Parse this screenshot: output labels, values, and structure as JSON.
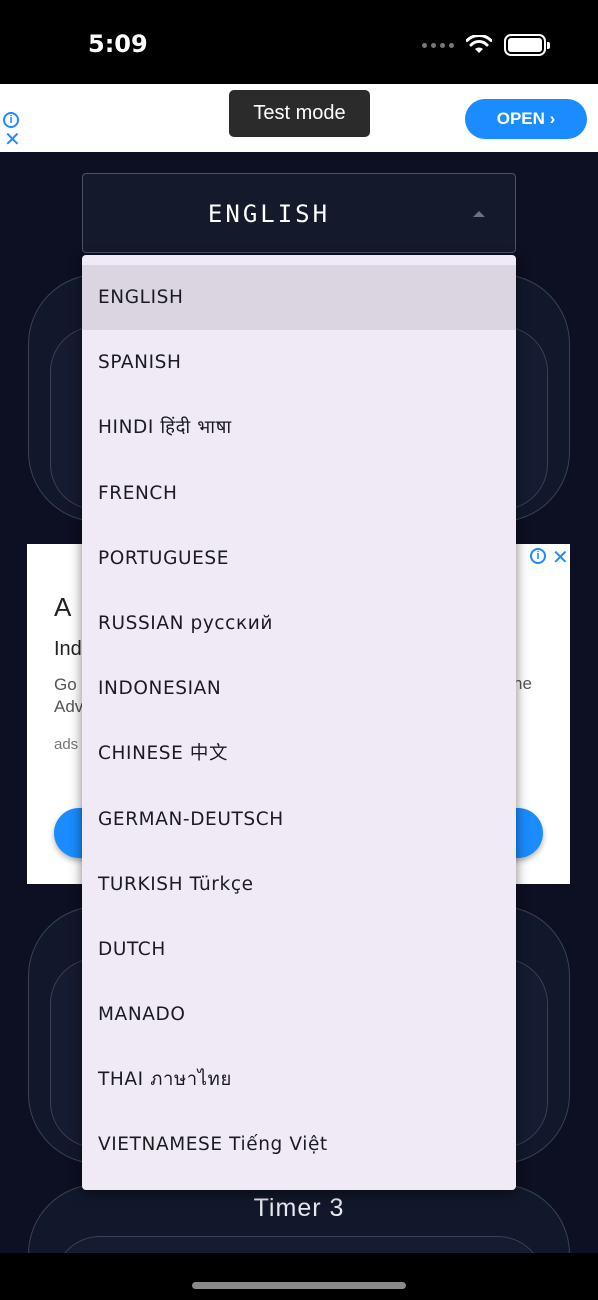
{
  "status_bar": {
    "time": "5:09",
    "icons": [
      "cellular-dots-icon",
      "wifi-icon",
      "battery-icon"
    ]
  },
  "top_ad": {
    "test_mode": "Test mode",
    "open_button": "OPEN ›",
    "icons": [
      "info-icon",
      "close-icon"
    ],
    "accent_color": "#1a8cff"
  },
  "language_select": {
    "selected": "ENGLISH",
    "options": [
      "ENGLISH",
      "SPANISH",
      "HINDI  हिंदी भाषा",
      "FRENCH",
      "PORTUGUESE",
      "RUSSIAN  русский",
      "INDONESIAN",
      "CHINESE  中文",
      "GERMAN-DEUTSCH",
      "TURKISH Türkçe",
      "DUTCH",
      "MANADO",
      "THAI  ภาษาไทย",
      "VIETNAMESE Tiếng Việt"
    ]
  },
  "mid_ad": {
    "title": "A",
    "subtitle": "Ind",
    "body_line1": "Go",
    "body_line2": "Adv",
    "url": "ads",
    "body_tail": "ne"
  },
  "timers": {
    "timer3_label": "Timer 3"
  }
}
